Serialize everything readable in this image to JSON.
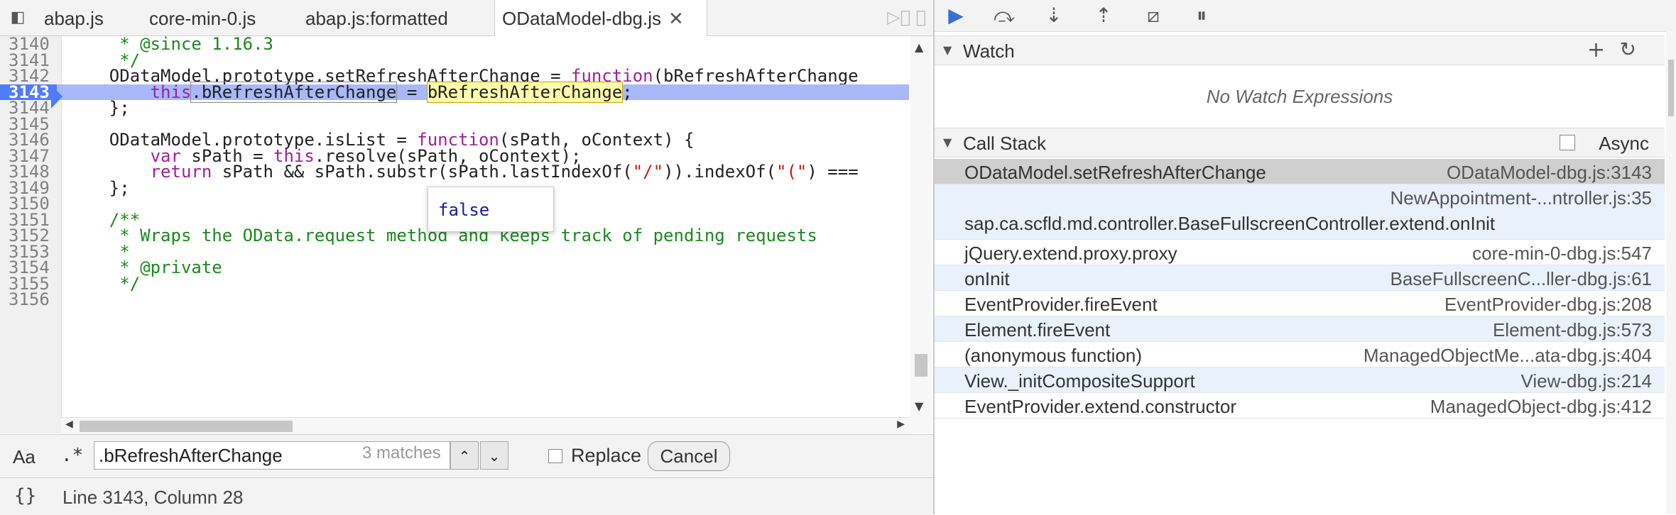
{
  "tabs": [
    {
      "label": "abap.js",
      "active": false
    },
    {
      "label": "core-min-0.js",
      "active": false
    },
    {
      "label": "abap.js:formatted",
      "active": false
    },
    {
      "label": "OData​Model-dbg.js",
      "active": true
    }
  ],
  "tab_close_glyph": "✕",
  "editor": {
    "lines": [
      {
        "n": "3140",
        "code": "     * @since 1.16.3"
      },
      {
        "n": "3141",
        "code": "     */"
      },
      {
        "n": "3142",
        "code": "    ODataModel.prototype.setRefreshAfterChange = function(bRefreshAfterChange"
      },
      {
        "n": "3143",
        "code": "        this.bRefreshAfterChange = bRefreshAfterChange;"
      },
      {
        "n": "3144",
        "code": "    };"
      },
      {
        "n": "3145",
        "code": ""
      },
      {
        "n": "3146",
        "code": "    ODataModel.prototype.isList = function(sPath, oContext) {"
      },
      {
        "n": "3147",
        "code": "        var sPath = this.resolve(sPath, oContext);"
      },
      {
        "n": "3148",
        "code": "        return sPath && sPath.substr(sPath.lastIndexOf(\"/\")).indexOf(\"(\") ==="
      },
      {
        "n": "3149",
        "code": "    };"
      },
      {
        "n": "3150",
        "code": ""
      },
      {
        "n": "3151",
        "code": "    /**"
      },
      {
        "n": "3152",
        "code": "     * Wraps the OData.request method and keeps track of pending requests"
      },
      {
        "n": "3153",
        "code": "     *"
      },
      {
        "n": "3154",
        "code": "     * @private"
      },
      {
        "n": "3155",
        "code": "     */"
      },
      {
        "n": "3156",
        "code": ""
      }
    ],
    "highlighted_line": "3143",
    "tooltip_value": "false"
  },
  "search": {
    "case_label": "Aa",
    "regex_label": ".*",
    "query": ".bRefreshAfterChange",
    "matches": "3 matches",
    "prev_glyph": "⌃",
    "next_glyph": "⌄",
    "replace_label": "Replace",
    "cancel_label": "Cancel"
  },
  "status": {
    "braces": "{}",
    "position": "Line 3143, Column 28"
  },
  "debugger": {
    "watch_title": "Watch",
    "no_watch": "No Watch Expressions",
    "callstack_title": "Call Stack",
    "async_label": "Async",
    "frames": [
      {
        "name": "ODataModel.setRefreshAfterChange",
        "loc": "ODataModel-dbg.js:3143",
        "selected": true
      },
      {
        "name": "sap.ca.scfld.md.controller.BaseFullscreenController.extend.onInit",
        "loc": "NewAppointment-...ntroller.js:35",
        "wrap": true
      },
      {
        "name": "jQuery.extend.proxy.proxy",
        "loc": "core-min-0-dbg.js:547"
      },
      {
        "name": "onInit",
        "loc": "BaseFullscreenC...ller-dbg.js:61"
      },
      {
        "name": "EventProvider.fireEvent",
        "loc": "EventProvider-dbg.js:208"
      },
      {
        "name": "Element.fireEvent",
        "loc": "Element-dbg.js:573"
      },
      {
        "name": "(anonymous function)",
        "loc": "ManagedObjectMe...ata-dbg.js:404"
      },
      {
        "name": "View._initCompositeSupport",
        "loc": "View-dbg.js:214"
      },
      {
        "name": "EventProvider.extend.constructor",
        "loc": "ManagedObject-dbg.js:412"
      }
    ]
  },
  "icons": {
    "nav": "◧",
    "resume": "▶",
    "step_over": "⤼",
    "step_into": "⇣",
    "step_out": "⇡",
    "deactivate": "⧄",
    "pause": "⏸",
    "add": "+",
    "refresh": "↻",
    "expand": "▼"
  }
}
